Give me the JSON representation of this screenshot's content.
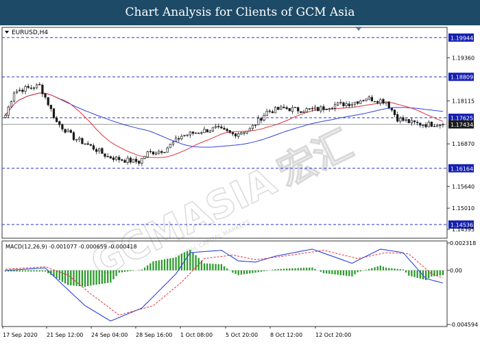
{
  "header": {
    "title": "Chart Analysis for Clients of GCM Asia"
  },
  "watermark": {
    "text": "GCMASIA",
    "chinese": "宏汇",
    "subtext": "© GLOBAL CAPITAL MARKETS"
  },
  "colors": {
    "header_bg": "#1d4a66",
    "level_line": "#2230c8",
    "label_bg": "#1620b0",
    "candle": "#1a1a1a",
    "ma_fast": "#e0303a",
    "ma_slow": "#3040d8",
    "macd_line": "#3040d8",
    "signal_line": "#e0303a",
    "histogram": "#2a9a2a"
  },
  "chart_data": [
    {
      "type": "candlestick",
      "symbol_label": "EURUSD,H4",
      "y_ticks": [
        "1.19360",
        "1.18115",
        "1.16870",
        "1.15640",
        "1.15010",
        "1.14395"
      ],
      "y_range": [
        1.142,
        1.202
      ],
      "levels": [
        {
          "label": "1.19944",
          "value": 1.19944
        },
        {
          "label": "1.18809",
          "value": 1.18809
        },
        {
          "label": "1.17625",
          "value": 1.17625
        },
        {
          "label": "1.16164",
          "value": 1.16164
        },
        {
          "label": "1.14536",
          "value": 1.14536
        }
      ],
      "current_price": {
        "label": "1.17434",
        "value": 1.17434
      },
      "x_labels": [
        "17 Sep 2020",
        "21 Sep 12:00",
        "24 Sep 04:00",
        "28 Sep 16:00",
        "1 Oct 08:00",
        "5 Oct 20:00",
        "8 Oct 12:00",
        "12 Oct 20:00"
      ],
      "close_anchors": [
        [
          0,
          1.177
        ],
        [
          3,
          1.1838
        ],
        [
          7,
          1.1847
        ],
        [
          12,
          1.1855
        ],
        [
          14,
          1.1822
        ],
        [
          18,
          1.175
        ],
        [
          24,
          1.1705
        ],
        [
          30,
          1.168
        ],
        [
          36,
          1.165
        ],
        [
          42,
          1.164
        ],
        [
          47,
          1.1635
        ],
        [
          50,
          1.166
        ],
        [
          56,
          1.167
        ],
        [
          62,
          1.171
        ],
        [
          68,
          1.1722
        ],
        [
          74,
          1.1732
        ],
        [
          80,
          1.1715
        ],
        [
          86,
          1.1728
        ],
        [
          92,
          1.178
        ],
        [
          98,
          1.179
        ],
        [
          104,
          1.1785
        ],
        [
          110,
          1.1787
        ],
        [
          116,
          1.18
        ],
        [
          122,
          1.1805
        ],
        [
          127,
          1.182
        ],
        [
          130,
          1.1815
        ],
        [
          134,
          1.181
        ],
        [
          138,
          1.176
        ],
        [
          143,
          1.1748
        ],
        [
          148,
          1.1743
        ],
        [
          152,
          1.1745
        ],
        [
          154,
          1.17434
        ]
      ],
      "ma_fast_period": 20,
      "ma_slow_period": 50
    },
    {
      "type": "macd",
      "label": "MACD(12,26,9) -0.001077 -0.000659 -0.000418",
      "y_ticks": [
        "0.002318",
        "0.00",
        "-0.004594"
      ],
      "y_range": [
        -0.004594,
        0.002318
      ],
      "macd_anchors": [
        [
          0,
          0.0
        ],
        [
          14,
          0.0002
        ],
        [
          20,
          -0.0012
        ],
        [
          28,
          -0.003
        ],
        [
          37,
          -0.0043
        ],
        [
          48,
          -0.0032
        ],
        [
          60,
          -0.0003
        ],
        [
          65,
          0.0015
        ],
        [
          76,
          0.0017
        ],
        [
          82,
          0.0008
        ],
        [
          88,
          0.0007
        ],
        [
          95,
          0.0012
        ],
        [
          108,
          0.0018
        ],
        [
          122,
          0.0006
        ],
        [
          132,
          0.0018
        ],
        [
          140,
          0.0015
        ],
        [
          148,
          -0.0007
        ],
        [
          154,
          -0.001077
        ]
      ],
      "signal_anchors": [
        [
          0,
          0.0001
        ],
        [
          14,
          0.0003
        ],
        [
          22,
          -0.0004
        ],
        [
          30,
          -0.002
        ],
        [
          40,
          -0.0038
        ],
        [
          52,
          -0.003
        ],
        [
          62,
          -0.001
        ],
        [
          70,
          0.001
        ],
        [
          80,
          0.0013
        ],
        [
          88,
          0.0009
        ],
        [
          98,
          0.0012
        ],
        [
          112,
          0.0017
        ],
        [
          124,
          0.001
        ],
        [
          134,
          0.0015
        ],
        [
          142,
          0.0014
        ],
        [
          150,
          -0.0003
        ],
        [
          154,
          -0.000659
        ]
      ],
      "histogram_end": -0.000418
    }
  ]
}
